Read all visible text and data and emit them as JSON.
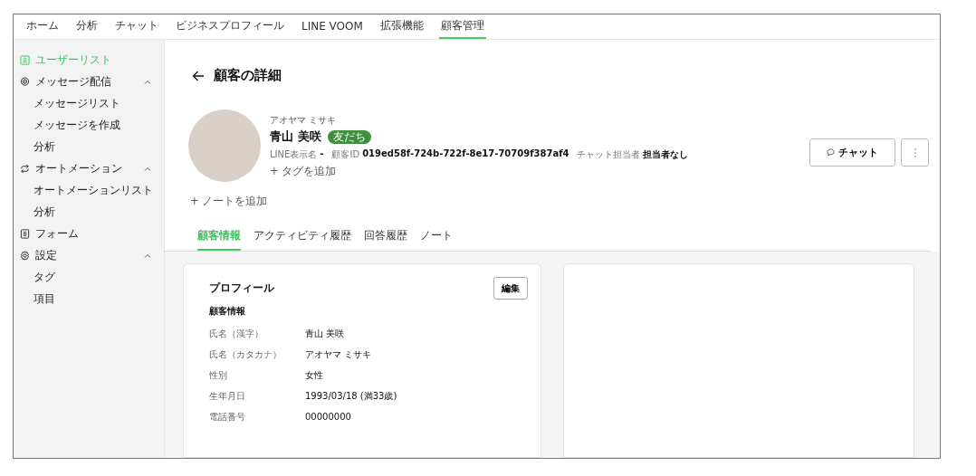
{
  "nav": [
    {
      "label": "ホーム",
      "selected": false
    },
    {
      "label": "分析",
      "selected": false
    },
    {
      "label": "チャット",
      "selected": false
    },
    {
      "label": "ビジネスプロフィール",
      "selected": false
    },
    {
      "label": "LINE VOOM",
      "selected": false
    },
    {
      "label": "拡張機能",
      "selected": false
    },
    {
      "label": "顧客管理",
      "selected": true
    }
  ],
  "sidebar": [
    {
      "label": "ユーザーリスト",
      "selected": true
    },
    {
      "label": "メッセージ配信",
      "selected": false,
      "expanded": true,
      "children": [
        {
          "label": "メッセージリスト",
          "selected": false
        },
        {
          "label": "メッセージを作成",
          "selected": false
        },
        {
          "label": "分析",
          "selected": false
        }
      ]
    },
    {
      "label": "オートメーション",
      "selected": false,
      "expanded": true,
      "children": [
        {
          "label": "オートメーションリスト",
          "selected": false
        },
        {
          "label": "分析",
          "selected": false
        }
      ]
    },
    {
      "label": "フォーム",
      "selected": false
    },
    {
      "label": "設定",
      "selected": false,
      "expanded": true,
      "children": [
        {
          "label": "タグ",
          "selected": false
        },
        {
          "label": "項目",
          "selected": false
        }
      ]
    }
  ],
  "page_title": "顧客の詳細",
  "customer": {
    "kana": "アオヤマ ミサキ",
    "name": "青山 美咲",
    "badge": "友だち",
    "meta": [
      {
        "label": "LINE表示名",
        "value": "-"
      },
      {
        "label": "顧客ID",
        "value": "019ed58f-724b-722f-8e17-70709f387af4"
      },
      {
        "label": "チャット担当者",
        "value": "担当者なし"
      }
    ],
    "add_tag": "+ タグを追加",
    "add_note": "+ ノートを追加"
  },
  "actions": {
    "chat": "チャット"
  },
  "tabs": [
    {
      "label": "顧客情報",
      "selected": true
    },
    {
      "label": "アクティビティ履歴",
      "selected": false
    },
    {
      "label": "回答履歴",
      "selected": false
    },
    {
      "label": "ノート",
      "selected": false
    }
  ],
  "profile": {
    "title": "プロフィール",
    "edit": "編集",
    "section": "顧客情報",
    "fields": [
      {
        "label": "氏名（漢字）",
        "value": "青山 美咲"
      },
      {
        "label": "氏名（カタカナ）",
        "value": "アオヤマ ミサキ"
      },
      {
        "label": "性別",
        "value": "女性"
      },
      {
        "label": "生年月日",
        "value": "1993/03/18 (満33歳)"
      },
      {
        "label": "電話番号",
        "value": "00000000"
      }
    ]
  }
}
